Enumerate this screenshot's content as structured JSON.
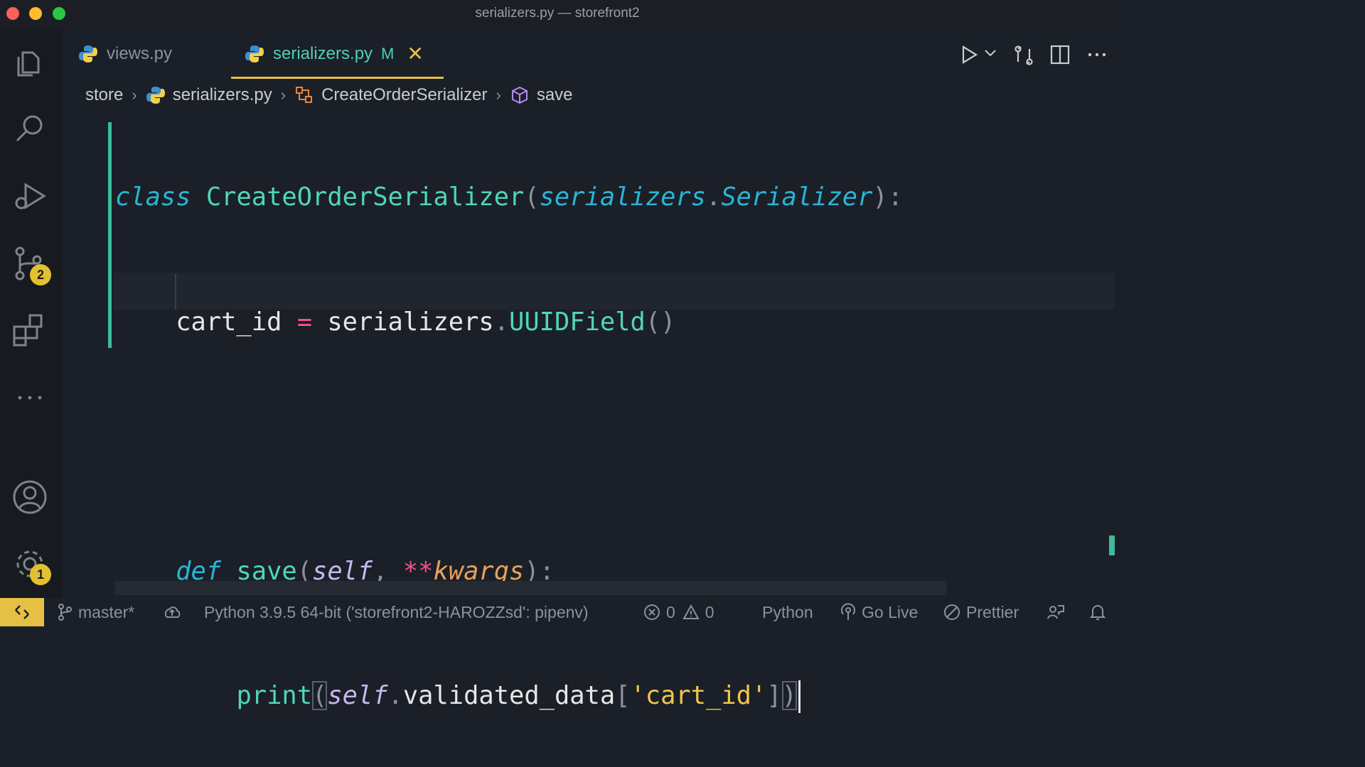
{
  "window": {
    "title": "serializers.py — storefront2"
  },
  "activity_bar": {
    "scm_badge": "2",
    "settings_badge": "1"
  },
  "tabs": [
    {
      "label": "views.py"
    },
    {
      "label": "serializers.py",
      "modified": "M"
    }
  ],
  "breadcrumbs": {
    "folder": "store",
    "file": "serializers.py",
    "class": "CreateOrderSerializer",
    "method": "save"
  },
  "code": {
    "line1": {
      "kw": "class",
      "name": "CreateOrderSerializer",
      "open": "(",
      "base_mod": "serializers",
      "dot": ".",
      "base_cls": "Serializer",
      "close": ")",
      "colon": ":"
    },
    "line2": {
      "var": "cart_id",
      "eq": "=",
      "mod": "serializers",
      "dot": ".",
      "call": "UUIDField",
      "parens": "()"
    },
    "line4": {
      "kw": "def",
      "name": "save",
      "open": "(",
      "self": "self",
      "comma": ",",
      "stars": "**",
      "kwargs": "kwargs",
      "close": ")",
      "colon": ":"
    },
    "line5": {
      "func": "print",
      "open": "(",
      "self": "self",
      "dot": ".",
      "attr": "validated_data",
      "lbr": "[",
      "str": "'cart_id'",
      "rbr": "]",
      "close": ")"
    }
  },
  "status_bar": {
    "branch": "master*",
    "interpreter": "Python 3.9.5 64-bit ('storefront2-HAROZZsd': pipenv)",
    "errors": "0",
    "warnings": "0",
    "language": "Python",
    "go_live": "Go Live",
    "prettier": "Prettier"
  }
}
